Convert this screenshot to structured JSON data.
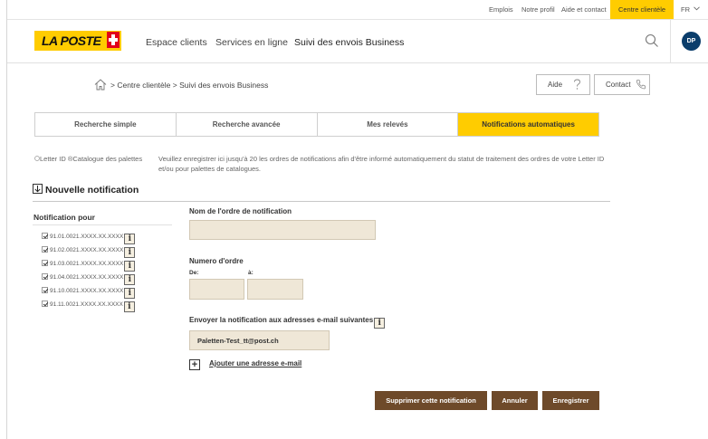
{
  "utility_bar": {
    "links": [
      "Emplois",
      "Notre profil",
      "Aide et contact"
    ],
    "active_link": "Centre clientèle",
    "language": "FR"
  },
  "header": {
    "logo_text": "LA POSTE",
    "nav": [
      "Espace clients",
      "Services en ligne",
      "Suivi des envois Business"
    ],
    "avatar_initials": "DP"
  },
  "breadcrumb": {
    "text": "> Centre clientèle > Suivi des envois Business"
  },
  "actions": {
    "help_label": "Aide",
    "contact_label": "Contact"
  },
  "tabs": [
    "Recherche simple",
    "Recherche avancée",
    "Mes relevés",
    "Notifications automatiques"
  ],
  "intro": {
    "radio_text": "Letter ID ®Catalogue des palettes",
    "description": "Veuillez enregistrer ici jusqu'à 20 les ordres de notifications afin d'être informé automatiquement du statut de traitement des ordres de votre Letter ID et/ou pour palettes de catalogues."
  },
  "new_notification_title": "Nouvelle notification",
  "notification_pour": {
    "title": "Notification pour",
    "items": [
      "91.01.0021.XXXX.XX.XXXX",
      "91.02.0021.XXXX.XX.XXXX",
      "91.03.0021.XXXX.XX.XXXX",
      "91.04.0021.XXXX.XX.XXXX",
      "91.10.0021.XXXX.XX.XXXX",
      "91.11.0021.XXXX.XX.XXXX"
    ]
  },
  "form": {
    "order_name_label": "Nom de l'ordre de notification",
    "order_name_value": "",
    "order_number_label": "Numero d'ordre",
    "from_label": "De:",
    "to_label": "à:",
    "from_value": "",
    "to_value": "",
    "email_label": "Envoyer la notification aux adresses e-mail suivantes",
    "email_value": "Paletten-Test_tt@post.ch",
    "add_email_label": "Ajouter une adresse e-mail"
  },
  "buttons": {
    "delete": "Supprimer cette notification",
    "cancel": "Annuler",
    "save": "Enregistrer"
  },
  "colors": {
    "brand_yellow": "#ffcc00",
    "button_brown": "#6e4a2a",
    "field_beige": "#efe7d7",
    "avatar_blue": "#0a3d6b"
  }
}
